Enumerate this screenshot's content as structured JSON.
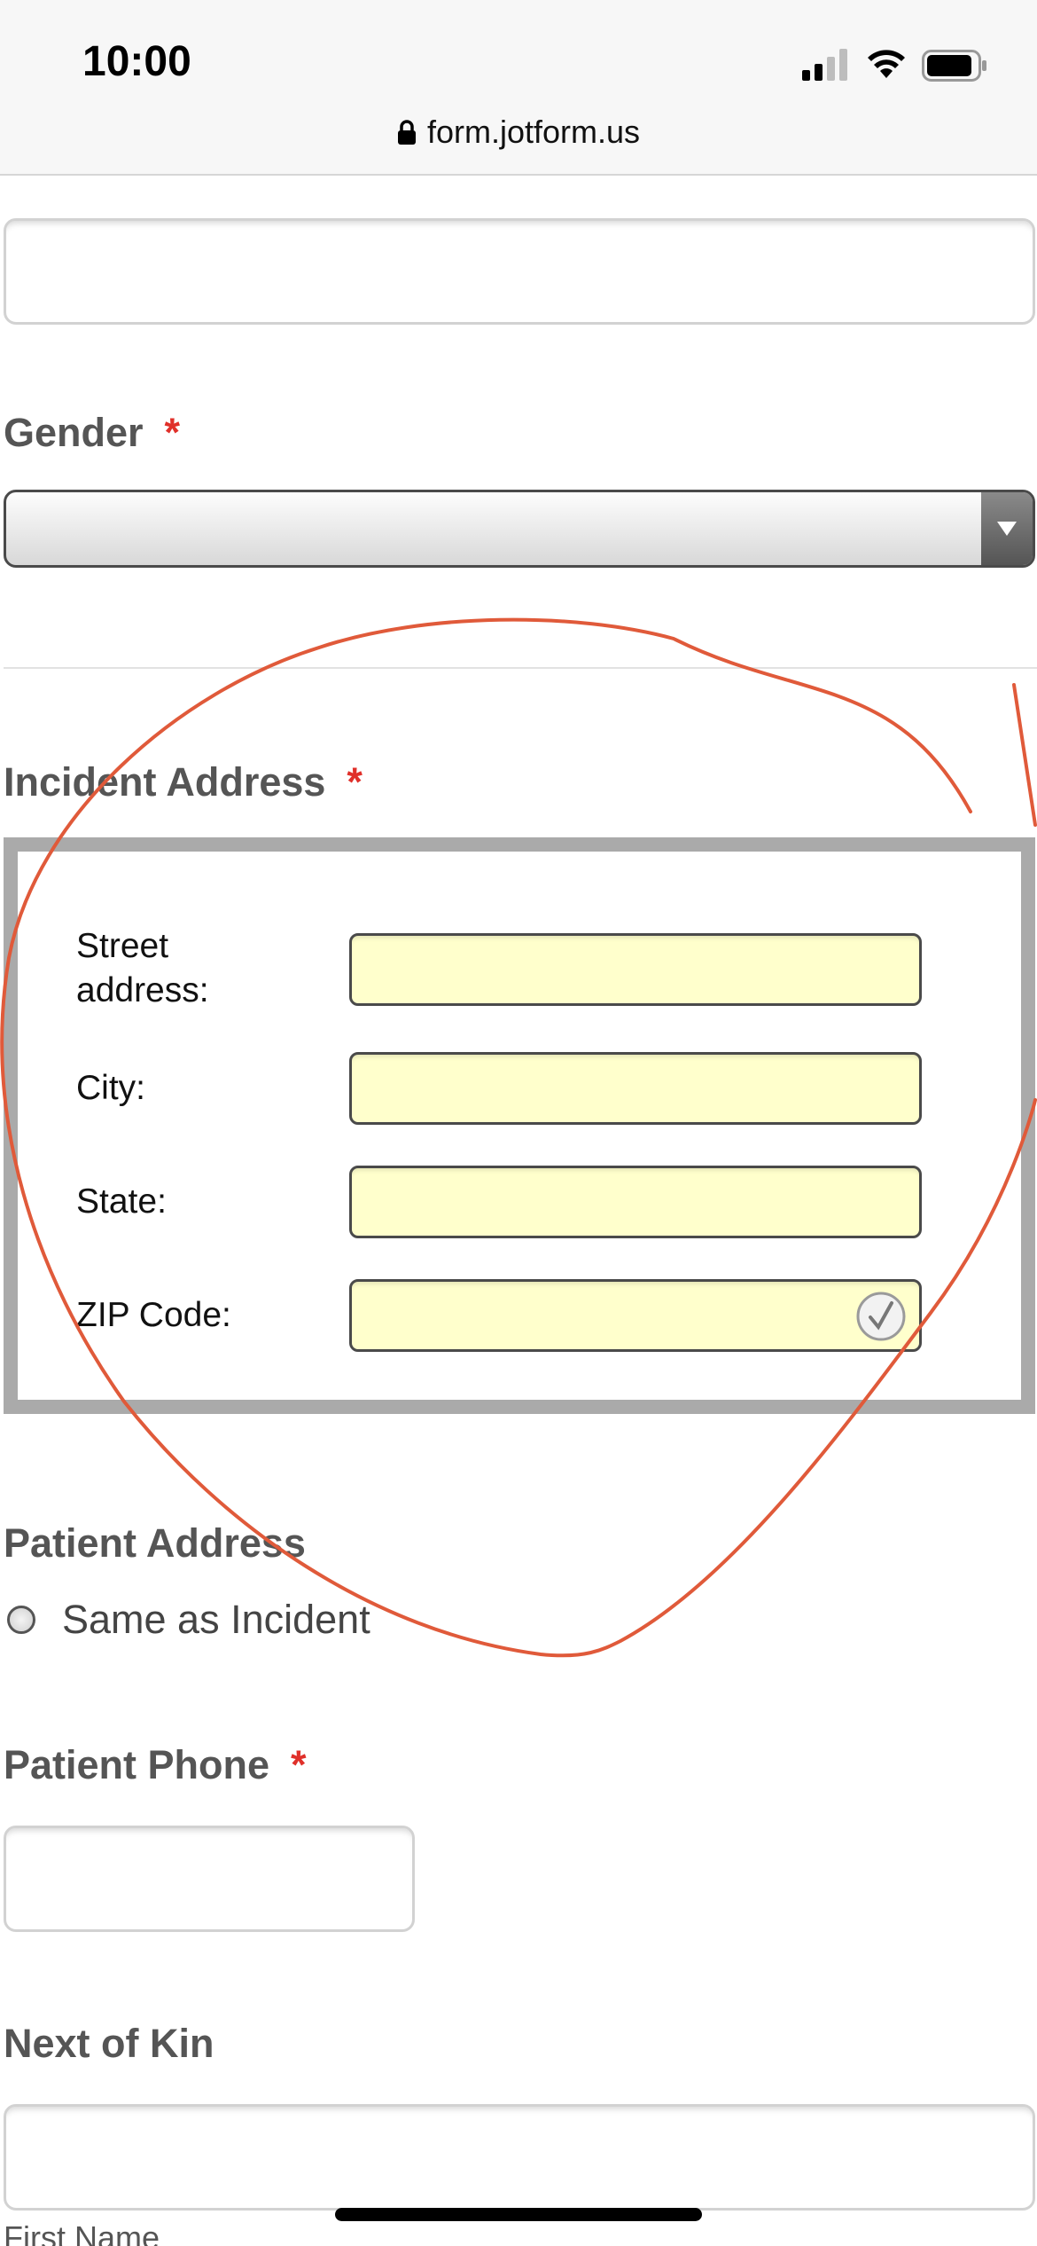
{
  "status_bar": {
    "time": "10:00",
    "icons": [
      "signal-icon",
      "wifi-icon",
      "battery-icon"
    ]
  },
  "browser": {
    "url": "form.jotform.us",
    "lock_icon": "lock-icon"
  },
  "form": {
    "gender": {
      "label": "Gender",
      "required_mark": "*",
      "selected_value": ""
    },
    "incident_address": {
      "label": "Incident Address",
      "required_mark": "*",
      "street_label": "Street\naddress:",
      "city_label": "City:",
      "state_label": "State:",
      "zip_label": "ZIP Code:",
      "street_value": "",
      "city_value": "",
      "state_value": "",
      "zip_value": ""
    },
    "patient_address": {
      "label": "Patient Address",
      "option_label": "Same as Incident"
    },
    "patient_phone": {
      "label": "Patient Phone",
      "required_mark": "*"
    },
    "next_of_kin": {
      "label": "Next of Kin",
      "first_name_sublabel": "First Name"
    }
  },
  "colors": {
    "required": "#e0302a",
    "address_input_bg": "#ffffcc",
    "annotation": "#e05a3a"
  }
}
